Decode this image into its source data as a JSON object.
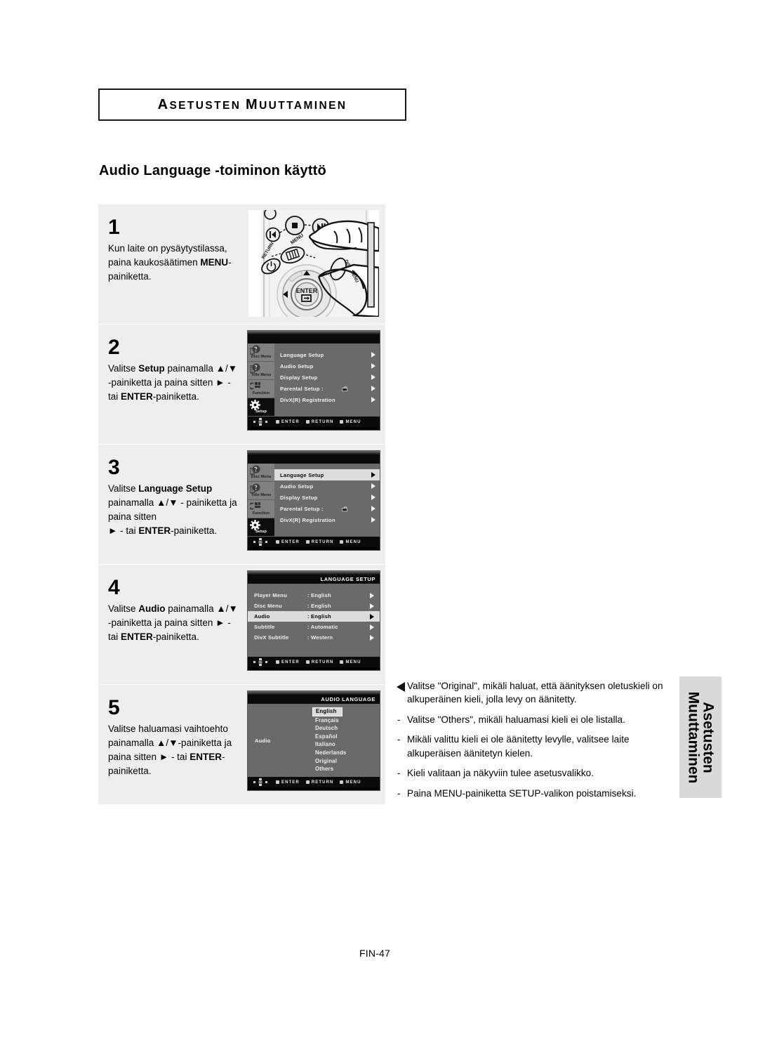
{
  "header": {
    "chapter": "ASETUSTEN MUUTTAMINEN",
    "chapter_parts": [
      "A",
      "SETUSTEN",
      "M",
      "UUTTAMINEN"
    ],
    "title": "Audio Language -toiminon käyttö"
  },
  "steps": [
    {
      "number": "1",
      "text_plain": "Kun laite on pysäytystilassa, paina kaukosäätimen MENU-painiketta.",
      "text_html": "Kun laite on pysäytystilassa, paina kaukosäätimen <b>MENU</b>-painiketta.",
      "media": "remote-illustration"
    },
    {
      "number": "2",
      "text_plain": "Valitse Setup painamalla ▲/▼ -painiketta ja paina sitten ► - tai ENTER-painiketta.",
      "text_html": "Valitse <b>Setup</b> painamalla <b>▲</b>/<b>▼</b> -painiketta ja paina sitten <b>►</b> - tai <b>ENTER</b>-painiketta.",
      "media": "setup-menu"
    },
    {
      "number": "3",
      "text_plain": "Valitse Language Setup painamalla ▲/▼ -painiketta ja paina sitten ► - tai ENTER-painiketta.",
      "text_html": "Valitse <b>Language Setup</b> painamalla <b>▲</b>/<b>▼</b> - painiketta ja paina sitten <br><b>►</b> - tai <b>ENTER</b>-painiketta.",
      "media": "setup-menu-highlighted"
    },
    {
      "number": "4",
      "text_plain": "Valitse Audio painamalla ▲/▼ -painiketta ja paina sitten ► - tai ENTER-painiketta.",
      "text_html": "Valitse <b>Audio</b> painamalla <b>▲</b>/<b>▼</b> -painiketta ja paina sitten <b>►</b> - tai <b>ENTER</b>-painiketta.",
      "media": "language-setup-menu"
    },
    {
      "number": "5",
      "text_plain": "Valitse haluamasi vaihtoehto painamalla ▲/▼-painiketta ja paina sitten ► - tai ENTER-painiketta.",
      "text_html": "Valitse haluamasi vaihtoehto painamalla <b>▲</b>/<b>▼</b>-painiketta ja paina sitten <b>►</b> - tai <b>ENTER</b>-painiketta.",
      "media": "audio-language-menu"
    }
  ],
  "osd": {
    "sidebar_items": [
      {
        "label": "Disc Menu",
        "icon": "disc-menu-icon",
        "active": false
      },
      {
        "label": "Title Menu",
        "icon": "title-menu-icon",
        "active": false
      },
      {
        "label": "Function",
        "icon": "function-icon",
        "active": false
      },
      {
        "label": "Setup",
        "icon": "gear-icon",
        "active": true
      }
    ],
    "setup_rows": [
      {
        "label": "Language Setup",
        "value": "",
        "arrow": true,
        "selected": false
      },
      {
        "label": "Audio Setup",
        "value": "",
        "arrow": true,
        "selected": false
      },
      {
        "label": "Display Setup",
        "value": "",
        "arrow": true,
        "selected": false
      },
      {
        "label": "Parental Setup :",
        "value": "",
        "arrow": true,
        "selected": false,
        "lock_icon": true
      },
      {
        "label": "DivX(R) Registration",
        "value": "",
        "arrow": true,
        "selected": false
      }
    ],
    "setup_rows_highlighted_index": 0,
    "language_setup": {
      "title": "LANGUAGE SETUP",
      "rows": [
        {
          "label": "Player Menu",
          "value": ": English",
          "selected": false
        },
        {
          "label": "Disc Menu",
          "value": ": English",
          "selected": false
        },
        {
          "label": "Audio",
          "value": ": English",
          "selected": true
        },
        {
          "label": "Subtitle",
          "value": ": Automatic",
          "selected": false
        },
        {
          "label": "DivX Subtitle",
          "value": ": Western",
          "selected": false
        }
      ]
    },
    "audio_language": {
      "title": "AUDIO LANGUAGE",
      "left_label": "Audio",
      "options": [
        {
          "label": "English",
          "selected": true
        },
        {
          "label": "Français",
          "selected": false
        },
        {
          "label": "Deutsch",
          "selected": false
        },
        {
          "label": "Español",
          "selected": false
        },
        {
          "label": "Italiano",
          "selected": false
        },
        {
          "label": "Nederlands",
          "selected": false
        },
        {
          "label": "Original",
          "selected": false
        },
        {
          "label": "Others",
          "selected": false
        }
      ]
    },
    "bottom_hints": [
      "ENTER",
      "RETURN",
      "MENU"
    ]
  },
  "notes": [
    "Valitse \"Original\", mikäli haluat, että äänityksen oletuskieli on alkuperäinen kieli, jolla levy on äänitetty.",
    "Valitse \"Others\", mikäli haluamasi kieli ei ole listalla.",
    "Mikäli valittu kieli ei ole äänitetty levylle, valitsee laite alkuperäisen äänitetyn kielen.",
    "Kieli valitaan ja näkyviin tulee asetusvalikko.",
    "Paina MENU-painiketta SETUP-valikon poistamiseksi."
  ],
  "note_bullet": "-",
  "side_tab": {
    "line1": "Asetusten",
    "line2": "Muuttaminen"
  },
  "footer": {
    "page": "FIN-47"
  },
  "colors": {
    "panel_bg": "#eeeeee",
    "osd_bg": "#6a6a6a",
    "osd_bar": "#0a0a0a",
    "osd_sidebar": "#808080",
    "highlight": "#dcdcdc",
    "side_tab_bg": "#d9d9d9"
  }
}
